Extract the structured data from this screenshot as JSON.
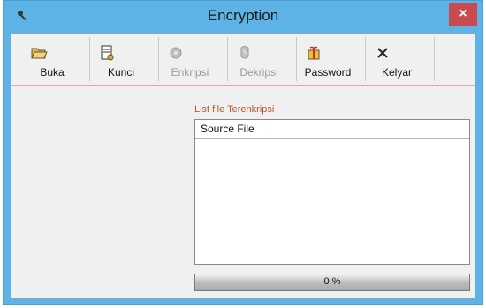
{
  "window": {
    "title": "Encryption",
    "close_glyph": "×"
  },
  "toolbar": {
    "items": [
      {
        "label": "Buka",
        "icon": "folder-open-icon",
        "enabled": true
      },
      {
        "label": "Kunci",
        "icon": "key-document-icon",
        "enabled": true
      },
      {
        "label": "Enkripsi",
        "icon": "encrypt-icon",
        "enabled": false
      },
      {
        "label": "Dekripsi",
        "icon": "decrypt-icon",
        "enabled": false
      },
      {
        "label": "Password",
        "icon": "password-gift-icon",
        "enabled": true
      },
      {
        "label": "Kelyar",
        "icon": "close-x-icon",
        "enabled": true
      }
    ]
  },
  "file_list": {
    "caption": "List file Terenkripsi",
    "column_header": "Source File",
    "rows": []
  },
  "progress": {
    "value_percent": 0,
    "text": "0 %"
  },
  "colors": {
    "title_bar": "#5db3e6",
    "close_button": "#c94a4f",
    "caption": "#b0582a"
  }
}
